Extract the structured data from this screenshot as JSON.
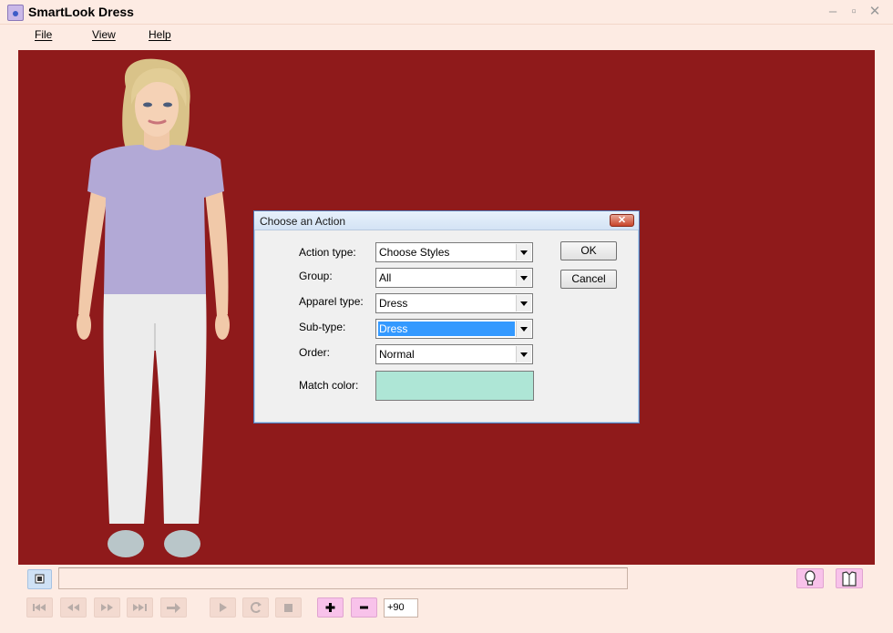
{
  "window": {
    "title": "SmartLook Dress"
  },
  "menu": [
    "File",
    "View",
    "Help"
  ],
  "dialog": {
    "title": "Choose an Action",
    "fields": [
      {
        "label": "Action type:",
        "value": "Choose Styles"
      },
      {
        "label": "Group:",
        "value": "All"
      },
      {
        "label": "Apparel type:",
        "value": "Dress"
      },
      {
        "label": "Sub-type:",
        "value": "Dress"
      },
      {
        "label": "Order:",
        "value": "Normal"
      }
    ],
    "match_color_label": "Match color:",
    "match_color": "#aee6d6",
    "ok_label": "OK",
    "cancel_label": "Cancel"
  },
  "toolbar": {
    "zoom_value": "+90"
  },
  "colors": {
    "stage_background": "#8f1a1b",
    "window_background": "#fdebe3",
    "selection": "#3399ff"
  }
}
